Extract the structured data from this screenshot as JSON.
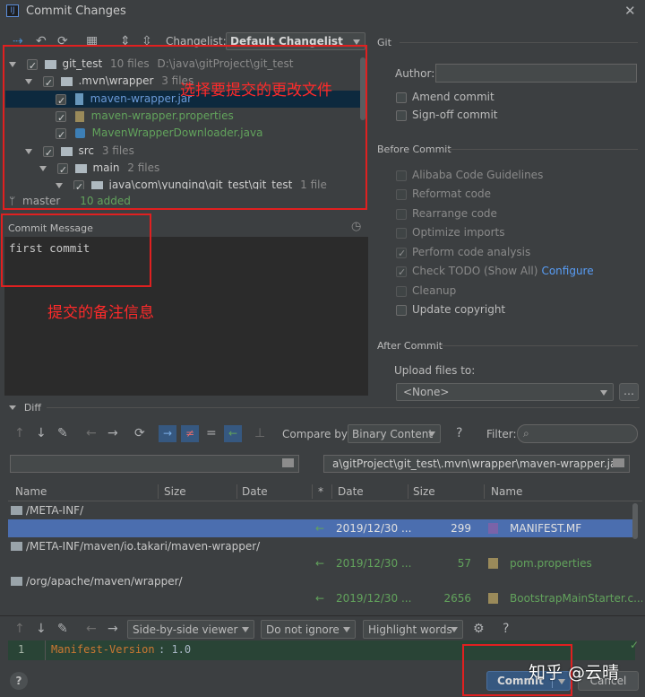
{
  "window": {
    "title": "Commit Changes"
  },
  "toolbar": {
    "changelist_label": "Changelist:",
    "changelist_value": "Default Changelist"
  },
  "tree": {
    "root": {
      "name": "git_test",
      "count": "10 files",
      "path": "D:\\java\\gitProject\\git_test"
    },
    "mvn_wrapper": {
      "name": ".mvn\\wrapper",
      "count": "3 files"
    },
    "files": [
      "maven-wrapper.jar",
      "maven-wrapper.properties",
      "MavenWrapperDownloader.java"
    ],
    "src": {
      "name": "src",
      "count": "3 files"
    },
    "main": {
      "name": "main",
      "count": "2 files"
    },
    "java_pkg": {
      "name": "java\\com\\yunqing\\git_test\\git_test",
      "count": "1 file"
    }
  },
  "status_bar": {
    "branch": "master",
    "added": "10 added"
  },
  "commit_message": {
    "label": "Commit Message",
    "text": "first commit"
  },
  "annotations": {
    "select_files": "选择要提交的更改文件",
    "commit_note": "提交的备注信息"
  },
  "git_panel": {
    "title": "Git",
    "author_label": "Author:",
    "author_value": "",
    "amend": "Amend commit",
    "signoff": "Sign-off commit"
  },
  "before_commit": {
    "title": "Before Commit",
    "options": [
      {
        "label": "Alibaba Code Guidelines",
        "checked": false,
        "enabled": false
      },
      {
        "label": "Reformat code",
        "checked": false,
        "enabled": false
      },
      {
        "label": "Rearrange code",
        "checked": false,
        "enabled": false
      },
      {
        "label": "Optimize imports",
        "checked": false,
        "enabled": false
      },
      {
        "label": "Perform code analysis",
        "checked": true,
        "enabled": false
      },
      {
        "label": "Check TODO (Show All)",
        "checked": true,
        "enabled": false
      },
      {
        "label": "Cleanup",
        "checked": false,
        "enabled": false
      },
      {
        "label": "Update copyright",
        "checked": false,
        "enabled": true
      }
    ],
    "configure_link": "Configure"
  },
  "after_commit": {
    "title": "After Commit",
    "upload_label": "Upload files to:",
    "upload_value": "<None>"
  },
  "diff": {
    "title": "Diff",
    "compare_label": "Compare by:",
    "compare_value": "Binary Content",
    "filter_label": "Filter:",
    "left_path": "",
    "right_path": "a\\gitProject\\git_test\\.mvn\\wrapper\\maven-wrapper.jar",
    "columns_left": [
      "Name",
      "Size",
      "Date"
    ],
    "columns_mid": "*",
    "columns_right": [
      "Date",
      "Size",
      "Name"
    ],
    "rows": [
      {
        "type": "dir",
        "name": "/META-INF/"
      },
      {
        "type": "file",
        "date": "2019/12/30 ...",
        "size": "299",
        "name": "MANIFEST.MF",
        "selected": true
      },
      {
        "type": "dir",
        "name": "/META-INF/maven/io.takari/maven-wrapper/"
      },
      {
        "type": "file",
        "date": "2019/12/30 ...",
        "size": "57",
        "name": "pom.properties",
        "selected": false
      },
      {
        "type": "dir",
        "name": "/org/apache/maven/wrapper/"
      },
      {
        "type": "file",
        "date": "2019/12/30 ...",
        "size": "2656",
        "name": "BootstrapMainStarter.c...",
        "selected": false
      }
    ]
  },
  "viewer": {
    "viewer_mode": "Side-by-side viewer",
    "ignore_mode": "Do not ignore",
    "highlight_mode": "Highlight words",
    "line_number": "1",
    "line_key": "Manifest-Version",
    "line_value": ": 1.0"
  },
  "footer": {
    "help": "?",
    "commit": "Commit",
    "cancel": "Cancel",
    "watermark": "知乎 @云晴"
  },
  "colors": {
    "accent": "#365880",
    "annotation": "#e02020",
    "selected_row": "#4b6eaf",
    "green_text": "#62a35c"
  }
}
